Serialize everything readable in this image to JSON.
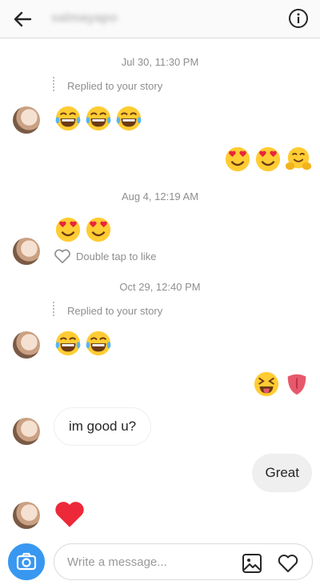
{
  "header": {
    "back_icon": "arrow-left-icon",
    "username": "salmayapo",
    "info_icon": "info-circle-icon"
  },
  "thread": {
    "timestamps": [
      "Jul 30, 11:30 PM",
      "Aug 4, 12:19 AM",
      "Oct 29, 12:40 PM"
    ],
    "replied_label": "Replied to your story",
    "double_tap_label": "Double tap to like",
    "messages": {
      "incoming_text": "im good u?",
      "outgoing_text": "Great"
    },
    "emoji_names": {
      "tears_of_joy": "face-with-tears-of-joy-emoji",
      "heart_eyes": "smiling-face-with-heart-eyes-emoji",
      "hugging": "hugging-face-emoji",
      "squinting_tongue": "squinting-face-with-tongue-emoji",
      "tongue": "tongue-emoji",
      "red_heart": "red-heart-emoji"
    }
  },
  "composer": {
    "placeholder": "Write a message...",
    "camera_icon": "camera-icon",
    "gallery_icon": "gallery-icon",
    "heart_icon": "heart-icon"
  },
  "colors": {
    "accent": "#3897f0",
    "timestamp_text": "#8e8e8e",
    "bubble_out_bg": "#efefef",
    "heart_red": "#ed2939",
    "emoji_yellow": "#ffcc33"
  }
}
